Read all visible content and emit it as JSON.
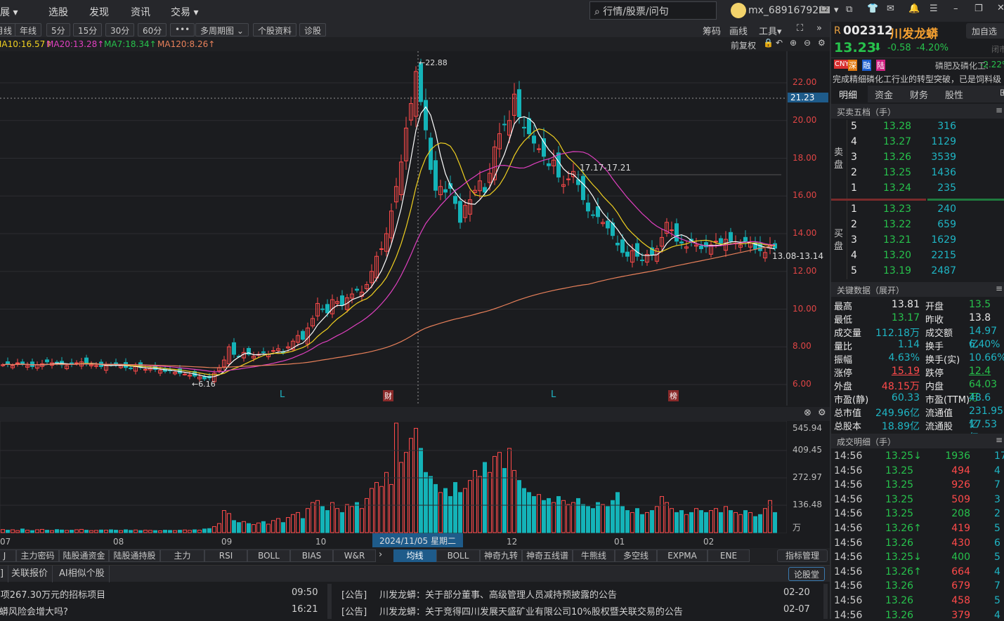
{
  "topbar": {
    "menus": [
      "扩展 ▾",
      "选股",
      "发现",
      "资讯",
      "交易 ▾"
    ],
    "search_placeholder": "行情/股票/问句",
    "username": "mx_689167929",
    "level_badge": "L2"
  },
  "toolbar": {
    "periods": [
      "月线",
      "年线",
      "5分",
      "15分",
      "30分",
      "60分",
      "•••",
      "多周期图 ⌄",
      "个股资料",
      "诊股"
    ],
    "right": [
      "筹码",
      "画线",
      "工具▾"
    ]
  },
  "ma_row": {
    "items": [
      {
        "label": "MA10:16.57↑",
        "color": "#f0d020"
      },
      {
        "label": "MA20:13.28↑",
        "color": "#e040c0"
      },
      {
        "label": "MA7:18.34↑",
        "color": "#27c24c"
      },
      {
        "label": "MA120:8.26↑",
        "color": "#e8805a"
      }
    ],
    "adjust": "前复权"
  },
  "price_axis": {
    "ticks": [
      "22.00",
      "20.00",
      "18.00",
      "16.00",
      "14.00",
      "12.00",
      "10.00",
      "8.00",
      "6.00"
    ],
    "crosshair_value": "21.23"
  },
  "annotations": {
    "high": "←22.88",
    "low": "←6.16",
    "range1": "17.17-17.21",
    "range2": "13.08-13.14",
    "markers": [
      "L",
      "财",
      "L",
      "榜"
    ]
  },
  "volume_axis": {
    "ticks": [
      "545.94",
      "409.45",
      "272.97",
      "136.48"
    ],
    "unit": "万"
  },
  "x_axis": {
    "months": [
      "07",
      "08",
      "09",
      "10",
      "12",
      "01",
      "02"
    ],
    "crosshair_date": "2024/11/05 星期二"
  },
  "chart_data": {
    "type": "candlestick",
    "title": "002312 川发龙蟒 日K",
    "ylim": [
      6,
      22.88
    ],
    "ma_periods": [
      5,
      10,
      20,
      120
    ],
    "close": [
      7.05,
      7.1,
      7.0,
      7.15,
      7.1,
      7.0,
      6.95,
      7.05,
      7.1,
      7.2,
      7.15,
      7.1,
      7.05,
      7.0,
      7.1,
      7.15,
      7.2,
      7.1,
      7.05,
      7.0,
      6.95,
      7.0,
      7.05,
      7.1,
      7.0,
      6.9,
      6.85,
      6.95,
      6.9,
      6.8,
      6.85,
      6.8,
      6.75,
      6.7,
      6.75,
      6.65,
      6.6,
      6.55,
      6.5,
      6.45,
      6.4,
      6.3,
      6.35,
      6.6,
      6.9,
      7.3,
      8.0,
      7.6,
      7.5,
      7.7,
      7.6,
      7.5,
      7.6,
      7.7,
      7.6,
      7.8,
      7.9,
      7.7,
      8.0,
      8.3,
      8.6,
      8.4,
      9.0,
      9.5,
      10.3,
      10.0,
      9.8,
      10.5,
      10.4,
      10.2,
      10.6,
      10.8,
      11.0,
      10.9,
      11.3,
      12.0,
      12.8,
      13.2,
      14.0,
      15.2,
      16.5,
      17.8,
      19.6,
      20.9,
      22.6,
      21.0,
      19.5,
      17.4,
      16.3,
      16.5,
      16.2,
      16.4,
      15.6,
      14.6,
      15.5,
      15.8,
      16.3,
      16.8,
      16.2,
      17.2,
      18.6,
      19.3,
      19.8,
      20.0,
      21.4,
      20.2,
      19.6,
      19.3,
      18.8,
      18.5,
      18.1,
      17.6,
      17.9,
      17.0,
      16.6,
      16.9,
      17.3,
      16.6,
      15.8,
      15.2,
      15.0,
      14.9,
      14.6,
      14.3,
      13.9,
      13.4,
      13.0,
      12.8,
      13.1,
      12.8,
      12.6,
      12.9,
      12.9,
      13.2,
      13.8,
      14.6,
      14.2,
      13.6,
      13.5,
      13.3,
      13.6,
      13.4,
      13.2,
      13.3,
      13.4,
      13.6,
      13.5,
      13.7,
      13.6,
      13.5,
      13.4,
      13.6,
      13.5,
      13.2,
      13.1,
      13.0,
      13.4,
      13.23
    ],
    "volume": [
      15,
      12,
      14,
      10,
      18,
      12,
      10,
      14,
      16,
      12,
      10,
      15,
      13,
      11,
      12,
      14,
      16,
      12,
      10,
      11,
      13,
      12,
      14,
      12,
      10,
      14,
      11,
      13,
      10,
      12,
      11,
      10,
      9,
      12,
      11,
      10,
      12,
      13,
      11,
      14,
      12,
      18,
      20,
      30,
      45,
      110,
      95,
      60,
      50,
      55,
      45,
      40,
      48,
      55,
      42,
      60,
      70,
      50,
      75,
      90,
      100,
      70,
      120,
      150,
      160,
      130,
      110,
      150,
      120,
      100,
      140,
      130,
      150,
      120,
      170,
      220,
      250,
      230,
      300,
      240,
      546,
      350,
      400,
      470,
      520,
      420,
      300,
      280,
      240,
      200,
      220,
      180,
      250,
      200,
      220,
      260,
      310,
      280,
      350,
      300,
      380,
      400,
      320,
      420,
      310,
      260,
      220,
      200,
      180,
      190,
      160,
      170,
      150,
      180,
      160,
      140,
      150,
      170,
      140,
      130,
      120,
      150,
      140,
      130,
      160,
      200,
      130,
      110,
      100,
      120,
      90,
      100,
      110,
      130,
      180,
      150,
      120,
      100,
      110,
      90,
      100,
      120,
      110,
      100,
      110,
      120,
      100,
      130,
      110,
      100,
      90,
      110,
      100,
      80,
      90,
      120,
      160,
      100
    ]
  },
  "indicator_tabs": {
    "left": [
      "J",
      "主力密码",
      "陆股通资金",
      "陆股通持股",
      "主力",
      "RSI",
      "BOLL",
      "BIAS",
      "W&R"
    ],
    "right": [
      "均线",
      "BOLL",
      "神奇九转",
      "神奇五线谱",
      "牛熊线",
      "多空线",
      "EXPMA",
      "ENE"
    ],
    "manage": "指标管理"
  },
  "bottom_tabs": {
    "items": [
      "]",
      "关联报价",
      "AI相似个股"
    ],
    "forum": "论股堂"
  },
  "news": {
    "left": [
      {
        "title": "-项267.30万元的招标项目",
        "time": "09:50"
      },
      {
        "title": "龙蟒风险会增大吗?",
        "time": "16:21"
      }
    ],
    "right": [
      {
        "tag": "[公告]",
        "title": "川发龙蟒：关于部分董事、高级管理人员减持预披露的公告",
        "date": "02-20"
      },
      {
        "tag": "[公告]",
        "title": "川发龙蟒：关于竞得四川发展天盛矿业有限公司10%股权暨关联交易的公告",
        "date": "02-07"
      }
    ]
  },
  "stock": {
    "prefix": "R",
    "code": "002312",
    "name": "川发龙蟒",
    "add_watch": "加自选",
    "price": "13.23",
    "change": "-0.58",
    "change_pct": "-4.20%",
    "status": "闭市",
    "tags": [
      "CNY",
      "深",
      "融",
      "陆"
    ],
    "sector": "磷肥及磷化工:",
    "sector_change": "-2.22%",
    "brief": "完成精细磷化工行业的转型突破，已是饲料级"
  },
  "right_tabs": [
    "明细",
    "资金",
    "财务",
    "股性"
  ],
  "orderbook": {
    "title": "买卖五档（手）",
    "sell_label": "卖盘",
    "buy_label": "买盘",
    "sell": [
      {
        "lvl": "5",
        "price": "13.28",
        "vol": "316"
      },
      {
        "lvl": "4",
        "price": "13.27",
        "vol": "1129"
      },
      {
        "lvl": "3",
        "price": "13.26",
        "vol": "3539"
      },
      {
        "lvl": "2",
        "price": "13.25",
        "vol": "1436"
      },
      {
        "lvl": "1",
        "price": "13.24",
        "vol": "235"
      }
    ],
    "buy": [
      {
        "lvl": "1",
        "price": "13.23",
        "vol": "240"
      },
      {
        "lvl": "2",
        "price": "13.22",
        "vol": "659"
      },
      {
        "lvl": "3",
        "price": "13.21",
        "vol": "1629"
      },
      {
        "lvl": "4",
        "price": "13.20",
        "vol": "2215"
      },
      {
        "lvl": "5",
        "price": "13.19",
        "vol": "2487"
      }
    ]
  },
  "keydata": {
    "title": "关键数据（展开）",
    "rows": [
      {
        "l1": "最高",
        "v1": "13.81",
        "c1": "w",
        "l2": "开盘",
        "v2": "13.5",
        "c2": "g"
      },
      {
        "l1": "最低",
        "v1": "13.17",
        "c1": "g",
        "l2": "昨收",
        "v2": "13.8",
        "c2": "w"
      },
      {
        "l1": "成交量",
        "v1": "112.18万",
        "c1": "c",
        "l2": "成交额",
        "v2": "14.97亿",
        "c2": "c"
      },
      {
        "l1": "量比",
        "v1": "1.14",
        "c1": "c",
        "l2": "换手",
        "v2": "6.40%",
        "c2": "c"
      },
      {
        "l1": "振幅",
        "v1": "4.63%",
        "c1": "c",
        "l2": "换手(实)",
        "v2": "10.66%",
        "c2": "c"
      },
      {
        "l1": "涨停",
        "v1": "15.19",
        "c1": "r",
        "l2": "跌停",
        "v2": "12.4",
        "c2": "g"
      },
      {
        "l1": "外盘",
        "v1": "48.15万",
        "c1": "r",
        "l2": "内盘",
        "v2": "64.03万",
        "c2": "g"
      },
      {
        "l1": "市盈(静)",
        "v1": "60.33",
        "c1": "c",
        "l2": "市盈(TTM)",
        "v2": "48.6",
        "c2": "c"
      },
      {
        "l1": "总市值",
        "v1": "249.96亿",
        "c1": "c",
        "l2": "流通值",
        "v2": "231.95亿",
        "c2": "c"
      },
      {
        "l1": "总股本",
        "v1": "18.89亿",
        "c1": "c",
        "l2": "流通股",
        "v2": "17.53亿",
        "c2": "c"
      }
    ]
  },
  "trades": {
    "title": "成交明细（手）",
    "rows": [
      {
        "t": "14:56",
        "p": "13.25↓",
        "v": "1936",
        "vc": "g",
        "n": "17"
      },
      {
        "t": "14:56",
        "p": "13.25",
        "v": "494",
        "vc": "r",
        "n": "4"
      },
      {
        "t": "14:56",
        "p": "13.25",
        "v": "926",
        "vc": "r",
        "n": "7"
      },
      {
        "t": "14:56",
        "p": "13.25",
        "v": "509",
        "vc": "r",
        "n": "3"
      },
      {
        "t": "14:56",
        "p": "13.25",
        "v": "208",
        "vc": "g",
        "n": "2"
      },
      {
        "t": "14:56",
        "p": "13.26↑",
        "v": "419",
        "vc": "r",
        "n": "5"
      },
      {
        "t": "14:56",
        "p": "13.26",
        "v": "430",
        "vc": "r",
        "n": "6"
      },
      {
        "t": "14:56",
        "p": "13.25↓",
        "v": "400",
        "vc": "g",
        "n": "5"
      },
      {
        "t": "14:56",
        "p": "13.26↑",
        "v": "664",
        "vc": "r",
        "n": "4"
      },
      {
        "t": "14:56",
        "p": "13.26",
        "v": "679",
        "vc": "r",
        "n": "7"
      },
      {
        "t": "14:56",
        "p": "13.26",
        "v": "458",
        "vc": "r",
        "n": "5"
      },
      {
        "t": "14:56",
        "p": "13.26",
        "v": "379",
        "vc": "r",
        "n": "4"
      }
    ]
  }
}
